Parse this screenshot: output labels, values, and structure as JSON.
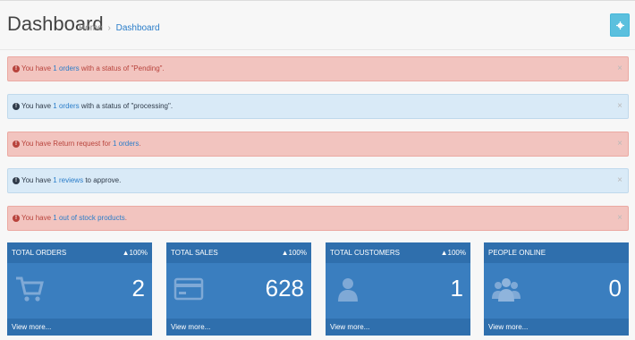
{
  "header": {
    "title": "Dashboard",
    "breadcrumb": {
      "home": "Home",
      "separator": "›",
      "current": "Dashboard"
    },
    "settings_icon": "gear-icon"
  },
  "alerts": [
    {
      "type": "danger",
      "text_before": "You have ",
      "link": "1 orders",
      "text_after": " with a status of \"Pending\".",
      "close": "×"
    },
    {
      "type": "info",
      "text_before": "You have ",
      "link": "1 orders",
      "text_after": " with a status of \"processing\".",
      "close": "×"
    },
    {
      "type": "danger",
      "text_before": "You have Return request for ",
      "link": "1 orders",
      "text_after": ".",
      "close": "×"
    },
    {
      "type": "info",
      "text_before": "You have ",
      "link": "1 reviews",
      "text_after": " to approve.",
      "close": "×"
    },
    {
      "type": "danger",
      "text_before": "You have ",
      "link": "1 out of stock products",
      "text_after": ".",
      "close": "×"
    }
  ],
  "tiles": [
    {
      "label": "Total Orders",
      "percent": "100%",
      "value": "2",
      "icon": "cart-icon",
      "footer": "View more..."
    },
    {
      "label": "Total Sales",
      "percent": "100%",
      "value": "628",
      "icon": "credit-card-icon",
      "footer": "View more..."
    },
    {
      "label": "Total Customers",
      "percent": "100%",
      "value": "1",
      "icon": "user-icon",
      "footer": "View more..."
    },
    {
      "label": "People Online",
      "percent": "",
      "value": "0",
      "icon": "users-icon",
      "footer": "View more..."
    }
  ],
  "colors": {
    "tile_bg": "#3a7ebf",
    "tile_header": "#2f6fad",
    "alert_danger_bg": "#f2c4bf",
    "alert_info_bg": "#d9eaf7",
    "link": "#2a7dc9"
  }
}
